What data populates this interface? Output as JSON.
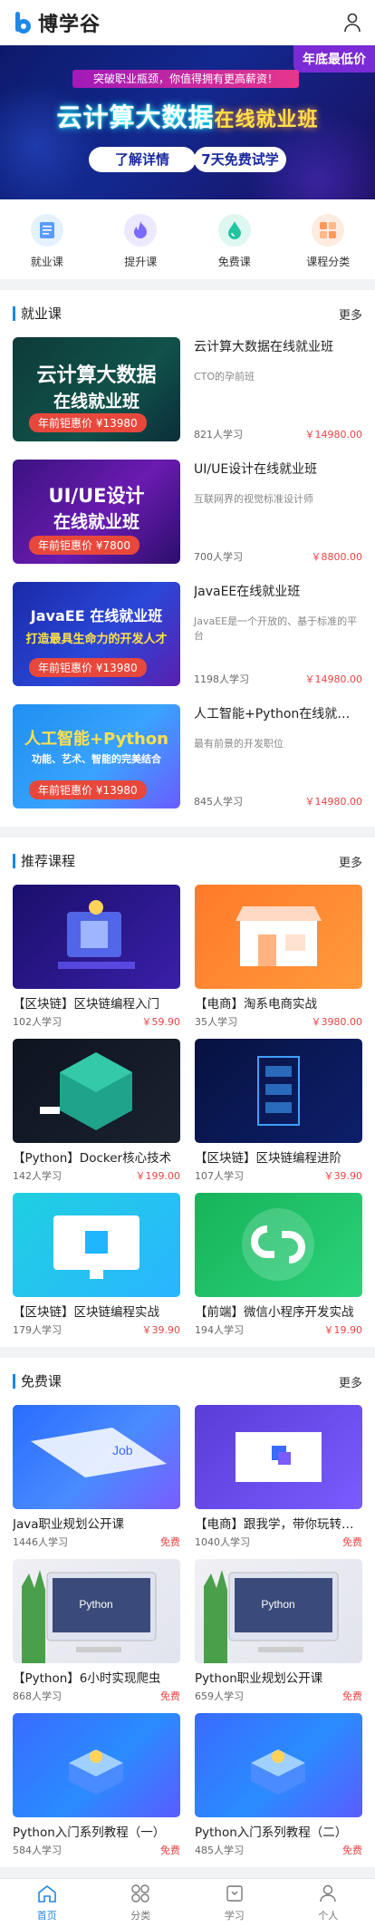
{
  "app": {
    "logo_text": "博学谷"
  },
  "banner": {
    "corner_tag": "年底最低价",
    "strip": "突破职业瓶颈，你值得拥有更高薪资！",
    "headline_main": "云计算大数据",
    "headline_tail": "在线就业班",
    "btn_detail": "了解详情",
    "btn_trial": "7天免费试学"
  },
  "quicknav": [
    {
      "label": "就业课",
      "icon": "book-icon",
      "color": "#e4f1ff"
    },
    {
      "label": "提升课",
      "icon": "flame-icon",
      "color": "#ece8ff"
    },
    {
      "label": "免费课",
      "icon": "drop-icon",
      "color": "#dff7f1"
    },
    {
      "label": "课程分类",
      "icon": "grid-icon",
      "color": "#ffece0"
    }
  ],
  "jobs": {
    "title": "就业课",
    "more": "更多",
    "items": [
      {
        "title": "云计算大数据在线就业班",
        "desc": "CTO的孕前班",
        "count": "821人学习",
        "price": "￥14980.00",
        "img_line1": "云计算大数据",
        "img_line2": "在线就业班",
        "img_price": "年前钜惠价 ¥13980"
      },
      {
        "title": "UI/UE设计在线就业班",
        "desc": "互联网界的视觉标准设计师",
        "count": "700人学习",
        "price": "￥8800.00",
        "img_line1": "UI/UE设计",
        "img_line2": "在线就业班",
        "img_price": "年前钜惠价 ¥7800"
      },
      {
        "title": "JavaEE在线就业班",
        "desc": "JavaEE是一个开放的、基于标准的平台",
        "count": "1198人学习",
        "price": "￥14980.00",
        "img_line1": "JavaEE 在线就业班",
        "img_line2": "打造最具生命力的开发人才",
        "img_price": "年前钜惠价 ¥13980"
      },
      {
        "title": "人工智能+Python在线就业班",
        "desc": "最有前景的开发职位",
        "count": "845人学习",
        "price": "￥14980.00",
        "img_line1": "人工智能+Python",
        "img_line2": "功能、艺术、智能的完美结合",
        "img_price": "年前钜惠价 ¥13980"
      }
    ]
  },
  "recommend": {
    "title": "推荐课程",
    "more": "更多",
    "items": [
      {
        "title": "【区块链】区块链编程入门",
        "count": "102人学习",
        "price": "￥59.90"
      },
      {
        "title": "【电商】淘系电商实战",
        "count": "35人学习",
        "price": "￥3980.00"
      },
      {
        "title": "【Python】Docker核心技术",
        "count": "142人学习",
        "price": "￥199.00"
      },
      {
        "title": "【区块链】区块链编程进阶",
        "count": "107人学习",
        "price": "￥39.90"
      },
      {
        "title": "【区块链】区块链编程实战",
        "count": "179人学习",
        "price": "￥39.90"
      },
      {
        "title": "【前端】微信小程序开发实战",
        "count": "194人学习",
        "price": "￥19.90"
      }
    ]
  },
  "free": {
    "title": "免费课",
    "more": "更多",
    "items": [
      {
        "title": "Java职业规划公开课",
        "count": "1446人学习",
        "price": "免费",
        "img_text": "Job"
      },
      {
        "title": "【电商】跟我学，带你玩转电商",
        "count": "1040人学习",
        "price": "免费",
        "img_text": ""
      },
      {
        "title": "【Python】6小时实现爬虫",
        "count": "868人学习",
        "price": "免费",
        "img_text": "Python"
      },
      {
        "title": "Python职业规划公开课",
        "count": "659人学习",
        "price": "免费",
        "img_text": "Python"
      },
      {
        "title": "Python入门系列教程（一）",
        "count": "584人学习",
        "price": "免费",
        "img_text": ""
      },
      {
        "title": "Python入门系列教程（二）",
        "count": "485人学习",
        "price": "免费",
        "img_text": ""
      }
    ]
  },
  "tabbar": [
    {
      "label": "首页",
      "icon": "home-icon",
      "active": true
    },
    {
      "label": "分类",
      "icon": "category-icon",
      "active": false
    },
    {
      "label": "学习",
      "icon": "study-icon",
      "active": false
    },
    {
      "label": "个人",
      "icon": "user-icon",
      "active": false
    }
  ]
}
